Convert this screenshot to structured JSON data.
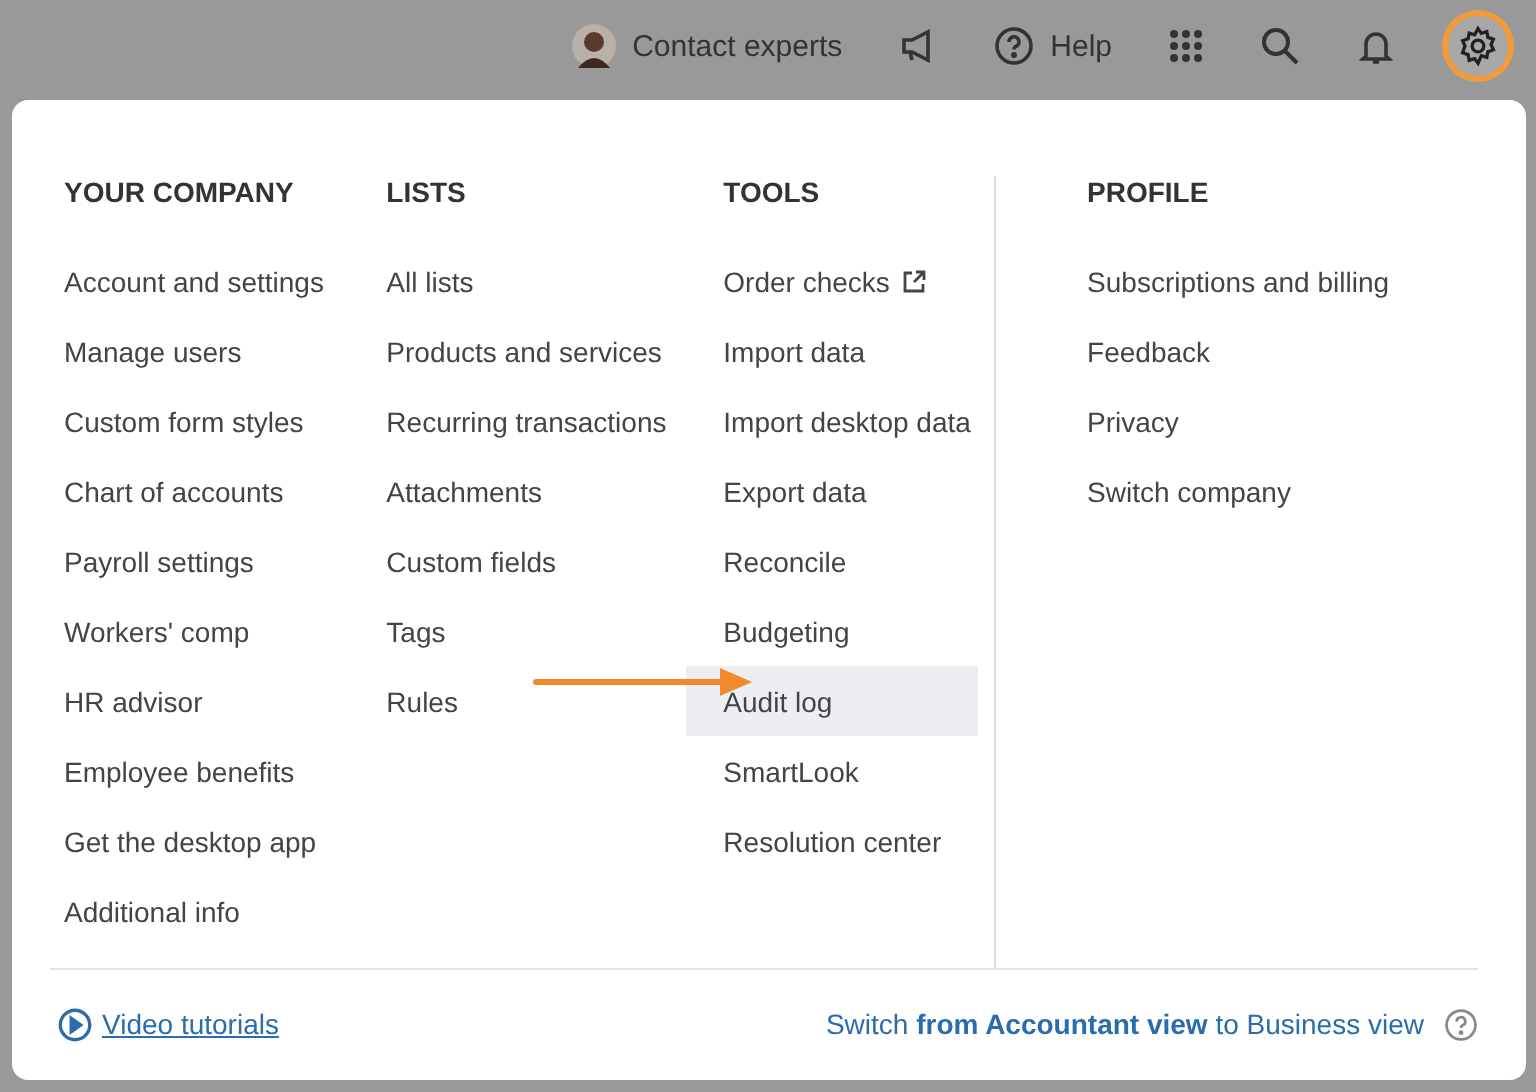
{
  "topbar": {
    "contact": "Contact experts",
    "help": "Help",
    "settings_active": true
  },
  "menu": {
    "columns": [
      {
        "heading": "YOUR COMPANY",
        "items": [
          {
            "label": "Account and settings",
            "selected": false
          },
          {
            "label": "Manage users",
            "selected": false
          },
          {
            "label": "Custom form styles",
            "selected": false
          },
          {
            "label": "Chart of accounts",
            "selected": false
          },
          {
            "label": "Payroll settings",
            "selected": false
          },
          {
            "label": "Workers' comp",
            "selected": false
          },
          {
            "label": "HR advisor",
            "selected": false
          },
          {
            "label": "Employee benefits",
            "selected": false
          },
          {
            "label": "Get the desktop app",
            "selected": false
          },
          {
            "label": "Additional info",
            "selected": false
          }
        ]
      },
      {
        "heading": "LISTS",
        "items": [
          {
            "label": "All lists",
            "selected": false
          },
          {
            "label": "Products and services",
            "selected": false
          },
          {
            "label": "Recurring transactions",
            "selected": false
          },
          {
            "label": "Attachments",
            "selected": false
          },
          {
            "label": "Custom fields",
            "selected": false
          },
          {
            "label": "Tags",
            "selected": false
          },
          {
            "label": "Rules",
            "selected": false
          }
        ]
      },
      {
        "heading": "TOOLS",
        "items": [
          {
            "label": "Order checks",
            "selected": false,
            "external": true
          },
          {
            "label": "Import data",
            "selected": false
          },
          {
            "label": "Import desktop data",
            "selected": false
          },
          {
            "label": "Export data",
            "selected": false
          },
          {
            "label": "Reconcile",
            "selected": false
          },
          {
            "label": "Budgeting",
            "selected": false
          },
          {
            "label": "Audit log",
            "selected": true
          },
          {
            "label": "SmartLook",
            "selected": false
          },
          {
            "label": "Resolution center",
            "selected": false
          }
        ]
      },
      {
        "heading": "PROFILE",
        "items": [
          {
            "label": "Subscriptions and billing",
            "selected": false
          },
          {
            "label": "Feedback",
            "selected": false
          },
          {
            "label": "Privacy",
            "selected": false
          },
          {
            "label": "Switch company",
            "selected": false
          }
        ]
      }
    ],
    "footer": {
      "video": "Video tutorials",
      "switch": "Switch **from Accountant view** to Business view"
    }
  }
}
